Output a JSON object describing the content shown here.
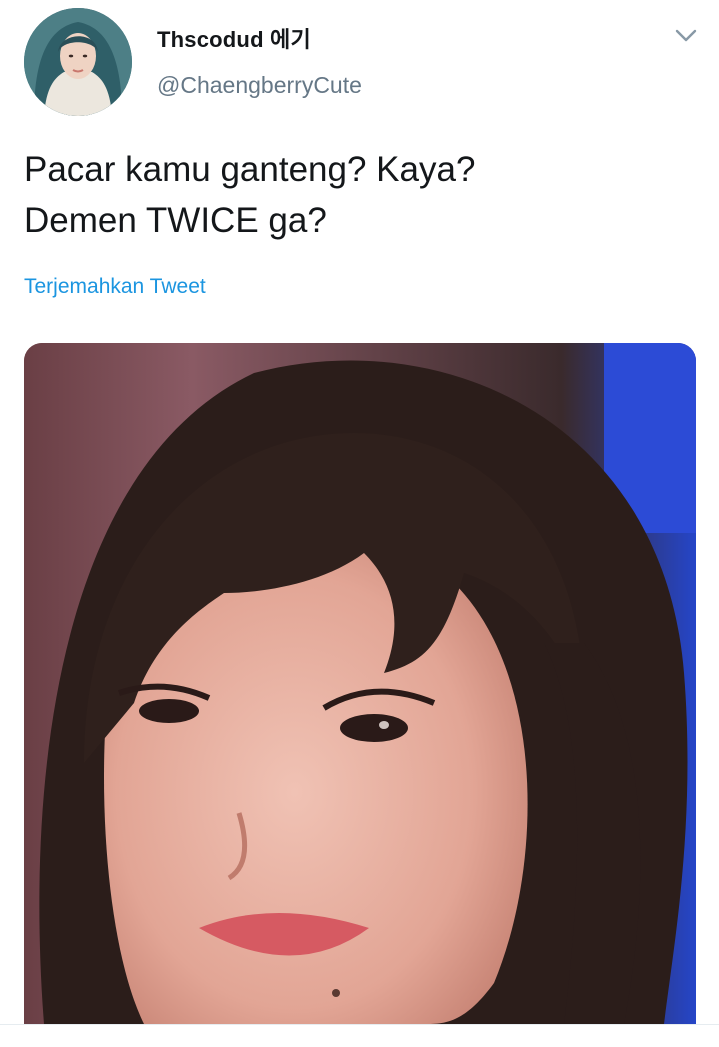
{
  "author": {
    "display_name": "Thscodud 에기",
    "handle": "@ChaengberryCute",
    "avatar_icon": "profile-avatar"
  },
  "tweet": {
    "lines": [
      "Pacar kamu ganteng? Kaya?",
      "Demen TWICE ga?"
    ],
    "translate_label": "Terjemahkan Tweet"
  },
  "menu": {
    "icon": "chevron-down-icon"
  },
  "colors": {
    "text": "#14171a",
    "secondary": "#657786",
    "link": "#1b95e0"
  }
}
